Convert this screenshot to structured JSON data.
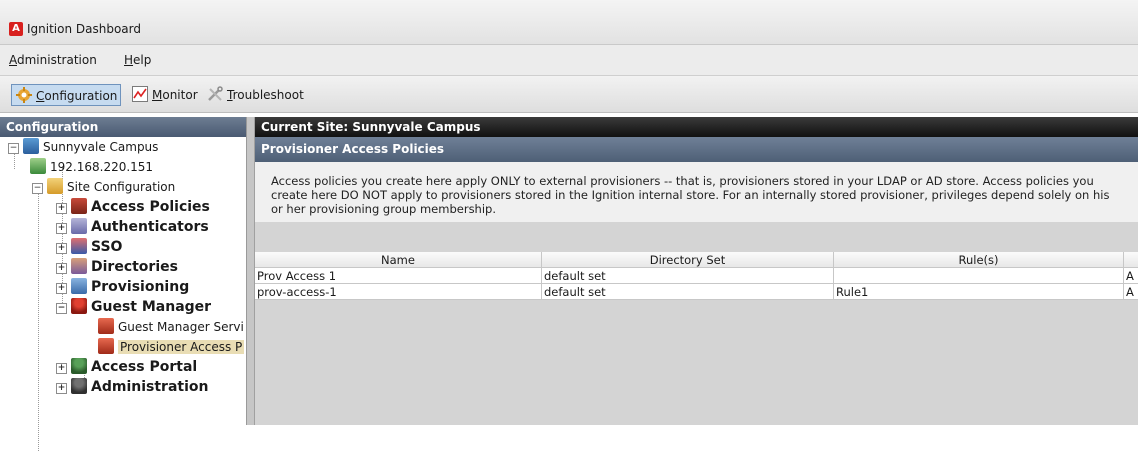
{
  "window": {
    "title": "Ignition Dashboard",
    "icon": "A"
  },
  "menu": {
    "items": [
      {
        "label": "Administration",
        "accel": "A",
        "rest": "dministration"
      },
      {
        "label": "Help",
        "accel": "H",
        "rest": "elp"
      }
    ]
  },
  "toolbar": {
    "configuration": {
      "accel": "C",
      "rest": "onfiguration"
    },
    "monitor": {
      "accel": "M",
      "rest": "onitor"
    },
    "troubleshoot": {
      "accel": "T",
      "rest": "roubleshoot"
    }
  },
  "left_pane": {
    "header": "Configuration",
    "tree": {
      "site": "Sunnyvale Campus",
      "ip": "192.168.220.151",
      "site_config": "Site Configuration",
      "access_policies": "Access Policies",
      "authenticators": "Authenticators",
      "sso": "SSO",
      "directories": "Directories",
      "provisioning": "Provisioning",
      "guest_manager": "Guest Manager",
      "guest_manager_service": "Guest Manager Servi",
      "provisioner_access": "Provisioner Access P",
      "access_portal": "Access Portal",
      "administration": "Administration"
    }
  },
  "right_pane": {
    "site_header": "Current Site:  Sunnyvale Campus",
    "section_header": "Provisioner Access Policies",
    "description": "Access policies you create here apply ONLY to external provisioners -- that is, provisioners stored in your LDAP or AD store. Access policies you create here DO NOT apply to provisioners stored in the Ignition internal store. For an internally stored provisioner, privileges depend solely on his or her provisioning group membership.",
    "table": {
      "columns": [
        "Name",
        "Directory Set",
        "Rule(s)",
        ""
      ],
      "rows": [
        [
          "Prov Access 1",
          "default set",
          "",
          "A"
        ],
        [
          "prov-access-1",
          "default set",
          "Rule1",
          "A"
        ]
      ]
    }
  }
}
